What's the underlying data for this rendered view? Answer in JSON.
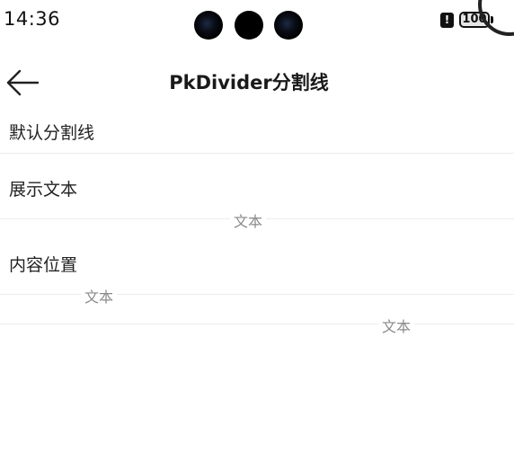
{
  "status_bar": {
    "time": "14:36",
    "battery": "100",
    "alert_glyph": "!"
  },
  "header": {
    "title": "PkDivider分割线",
    "back_icon": "arrow-left-icon"
  },
  "sections": {
    "default_divider": {
      "label": "默认分割线"
    },
    "show_text": {
      "label": "展示文本",
      "divider_text": "文本"
    },
    "content_position": {
      "label": "内容位置",
      "left_text": "文本",
      "right_text": "文本"
    }
  }
}
